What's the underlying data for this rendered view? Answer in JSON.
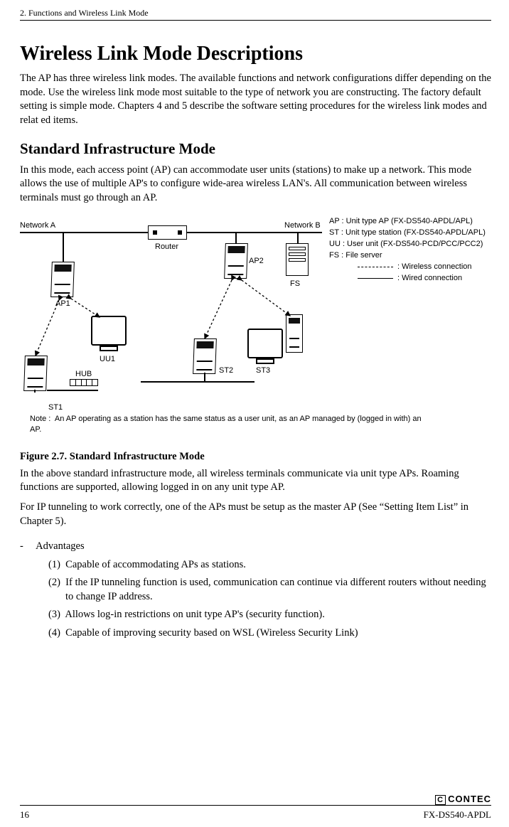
{
  "header": {
    "running": "2. Functions and Wireless Link Mode"
  },
  "title": "Wireless Link Mode Descriptions",
  "intro": "The AP has three wireless link modes.  The available functions and network configurations differ depending on the mode.  Use the wireless link mode most suitable to the type of network you are constructing.  The factory default setting is simple mode.  Chapters 4 and 5 describe the software setting procedures for the wireless link modes and relat ed items.",
  "section1": {
    "heading": "Standard Infrastructure Mode",
    "para": "In this mode, each access point (AP) can accommodate user units (stations) to make up a network.  This mode allows the use of multiple AP's to configure wide-area wireless LAN's.  All communication between wireless terminals must go through an AP."
  },
  "figure": {
    "labels": {
      "networkA": "Network A",
      "networkB": "Network B",
      "router": "Router",
      "ap1": "AP1",
      "ap2": "AP2",
      "fs": "FS",
      "uu1": "UU1",
      "hub": "HUB",
      "st1": "ST1",
      "st2": "ST2",
      "st3": "ST3"
    },
    "legend": {
      "ap": "AP  : Unit type AP (FX-DS540-APDL/APL)",
      "st": "ST  : Unit type station (FX-DS540-APDL/APL)",
      "uu": "UU : User unit (FX-DS540-PCD/PCC/PCC2)",
      "fs": "FS  : File server",
      "wireless": ": Wireless connection",
      "wired": ": Wired connection"
    },
    "note_label": "Note :",
    "note": "An AP operating as a station has the same status as a user unit, as an AP managed by (logged in with) an AP.",
    "caption": "Figure 2.7.  Standard Infrastructure Mode"
  },
  "after_fig": {
    "p1": "In the above standard infrastructure mode, all wireless terminals communicate via unit type APs.  Roaming functions are supported, allowing logged in on any unit type AP.",
    "p2": "For IP tunneling to work correctly, one of the APs must be setup as the master AP (See “Setting Item List” in Chapter 5)."
  },
  "advantages": {
    "dash": "-",
    "heading": "Advantages",
    "items": [
      "Capable of accommodating APs as stations.",
      "If the IP tunneling function is used, communication can continue via different routers without needing to change IP address.",
      "Allows log-in restrictions on unit type AP's (security function).",
      "Capable of improving security based on WSL (Wireless Security Link)"
    ]
  },
  "footer": {
    "page": "16",
    "brand": "CONTEC",
    "model": "FX-DS540-APDL"
  }
}
